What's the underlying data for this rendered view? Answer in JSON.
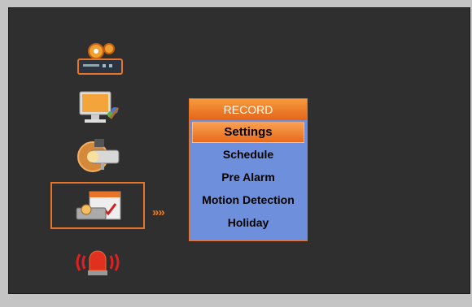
{
  "menu": {
    "title": "RECORD",
    "items": [
      {
        "label": "Settings",
        "selected": true
      },
      {
        "label": "Schedule",
        "selected": false
      },
      {
        "label": "Pre Alarm",
        "selected": false
      },
      {
        "label": "Motion Detection",
        "selected": false
      },
      {
        "label": "Holiday",
        "selected": false
      }
    ]
  },
  "icons": [
    {
      "name": "system-settings-icon"
    },
    {
      "name": "display-icon"
    },
    {
      "name": "camera-icon"
    },
    {
      "name": "record-icon",
      "selected": true
    },
    {
      "name": "alarm-icon"
    }
  ],
  "arrows_indicator": "»»",
  "colors": {
    "accent": "#e8742a",
    "menu_bg": "#6e8fdb",
    "screen_bg": "#2f2f2f"
  }
}
